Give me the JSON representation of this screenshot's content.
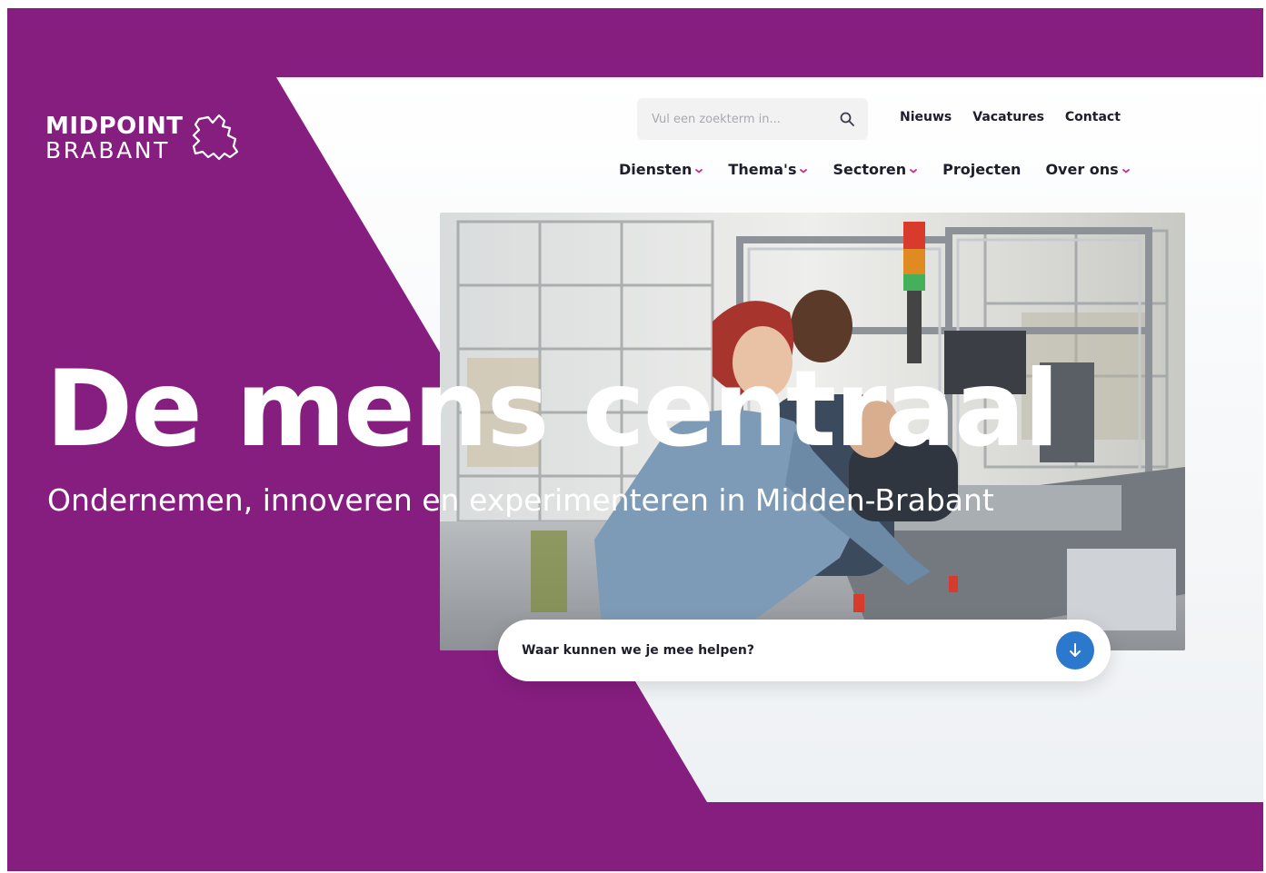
{
  "brand": {
    "line1": "MIDPOINT",
    "line2": "BRABANT",
    "icon": "brabant-map-icon"
  },
  "search": {
    "placeholder": "Vul een zoekterm in...",
    "icon": "search-icon"
  },
  "util_nav": [
    "Nieuws",
    "Vacatures",
    "Contact"
  ],
  "main_nav": [
    {
      "label": "Diensten",
      "dropdown": true
    },
    {
      "label": "Thema's",
      "dropdown": true
    },
    {
      "label": "Sectoren",
      "dropdown": true
    },
    {
      "label": "Projecten",
      "dropdown": false
    },
    {
      "label": "Over ons",
      "dropdown": true
    }
  ],
  "hero": {
    "title": "De mens centraal",
    "subtitle": "Ondernemen, innoveren en experimenteren in Midden-Brabant"
  },
  "help": {
    "label": "Waar kunnen we je mee helpen?",
    "icon": "arrow-down-icon"
  },
  "colors": {
    "purple": "#861e80",
    "accent_pink": "#c4319f",
    "button_blue": "#2b78cc",
    "text_dark": "#1d1d2b"
  }
}
